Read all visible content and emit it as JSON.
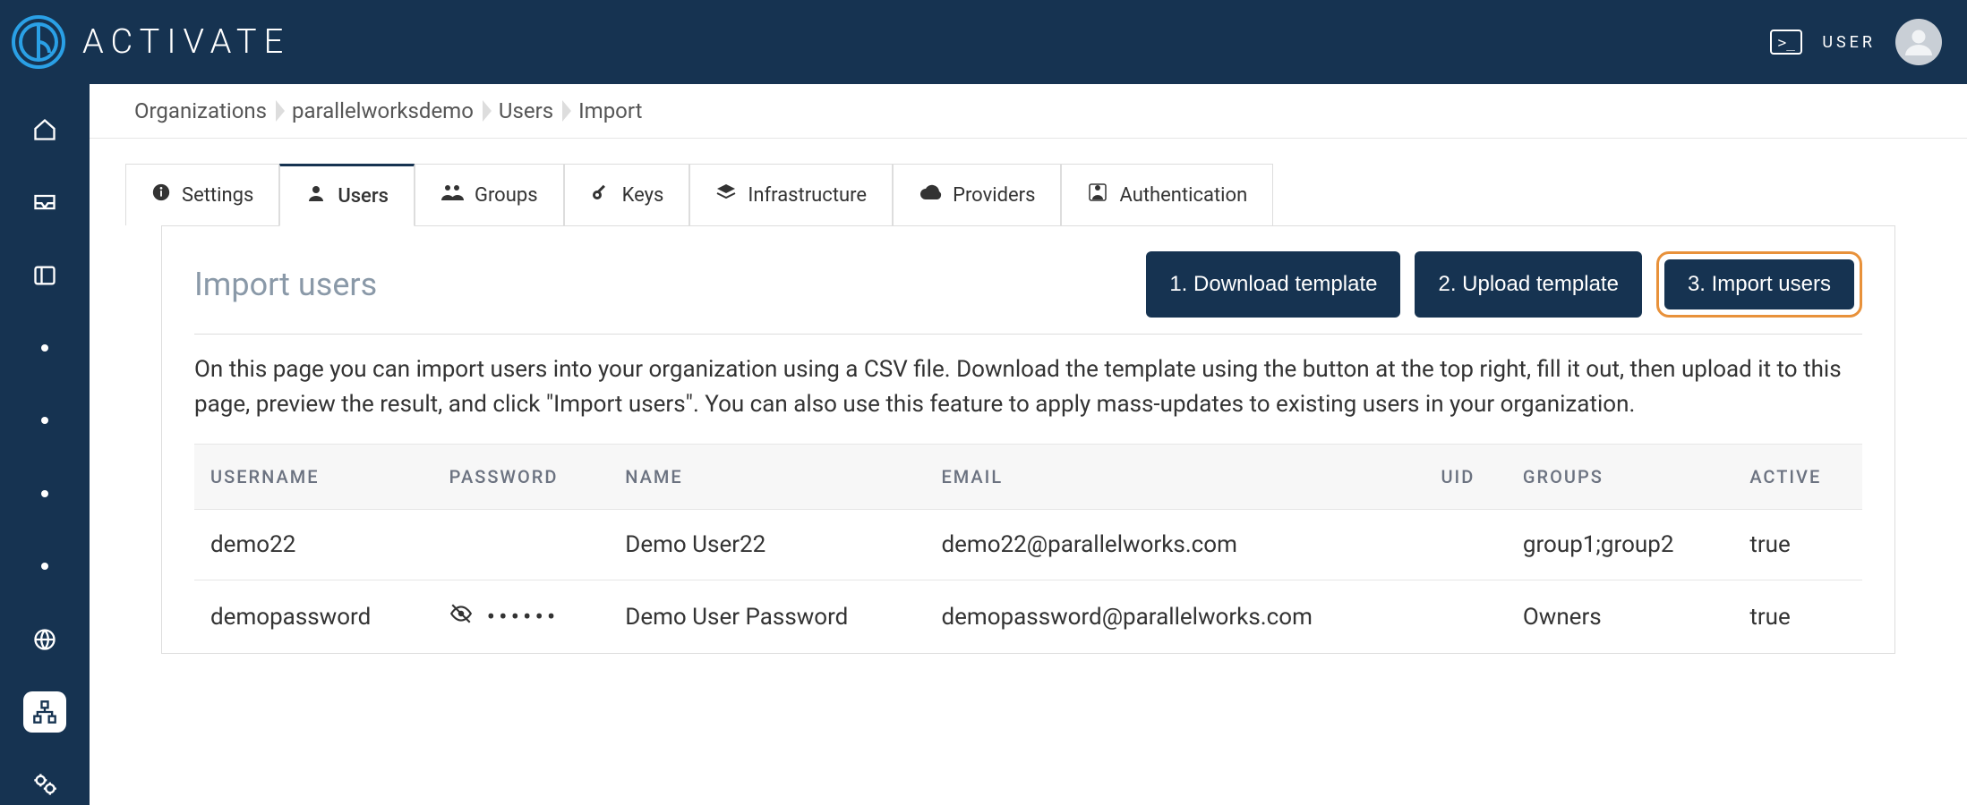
{
  "header": {
    "brand_name": "ACTIVATE",
    "user_label": "USER"
  },
  "breadcrumb": [
    "Organizations",
    "parallelworksdemo",
    "Users",
    "Import"
  ],
  "tabs": [
    {
      "label": "Settings",
      "icon": "info"
    },
    {
      "label": "Users",
      "icon": "user"
    },
    {
      "label": "Groups",
      "icon": "groups"
    },
    {
      "label": "Keys",
      "icon": "key"
    },
    {
      "label": "Infrastructure",
      "icon": "layers"
    },
    {
      "label": "Providers",
      "icon": "cloud"
    },
    {
      "label": "Authentication",
      "icon": "badge"
    }
  ],
  "active_tab_index": 1,
  "page": {
    "title": "Import users",
    "description": "On this page you can import users into your organization using a CSV file. Download the template using the button at the top right, fill it out, then upload it to this page, preview the result, and click \"Import users\". You can also use this feature to apply mass-updates to existing users in your organization."
  },
  "actions": [
    {
      "label": "1. Download template",
      "highlighted": false
    },
    {
      "label": "2. Upload template",
      "highlighted": false
    },
    {
      "label": "3. Import users",
      "highlighted": true
    }
  ],
  "table": {
    "columns": [
      "USERNAME",
      "PASSWORD",
      "NAME",
      "EMAIL",
      "UID",
      "GROUPS",
      "ACTIVE"
    ],
    "rows": [
      {
        "username": "demo22",
        "password_masked": false,
        "password_display": "",
        "name": "Demo User22",
        "email": "demo22@parallelworks.com",
        "uid": "",
        "groups": "group1;group2",
        "active": "true"
      },
      {
        "username": "demopassword",
        "password_masked": true,
        "password_display": "••••••",
        "name": "Demo User Password",
        "email": "demopassword@parallelworks.com",
        "uid": "",
        "groups": "Owners",
        "active": "true"
      }
    ]
  }
}
